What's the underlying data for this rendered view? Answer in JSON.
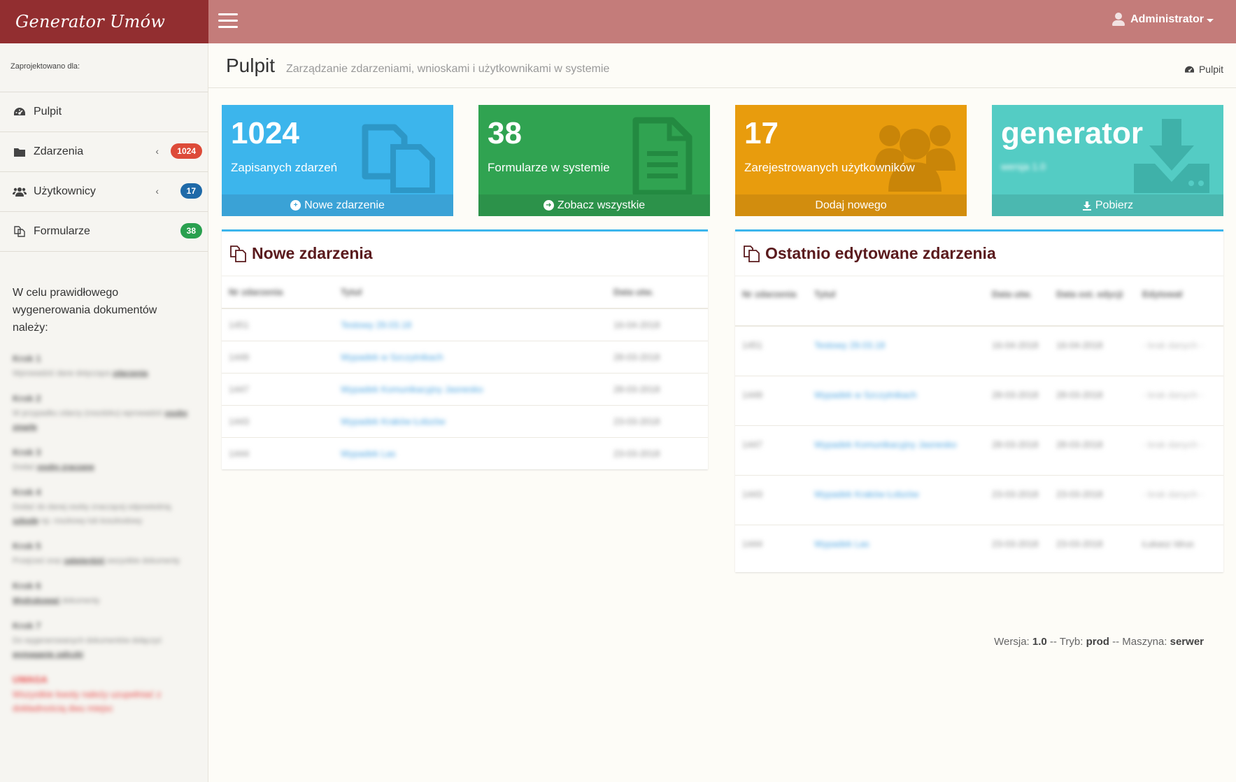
{
  "brand": "Generator Umów",
  "user": {
    "name": "Administrator"
  },
  "sidebar": {
    "designed_for": "Zaprojektowano dla:",
    "items": [
      {
        "label": "Pulpit",
        "icon": "dashboard-icon"
      },
      {
        "label": "Zdarzenia",
        "icon": "folder-icon",
        "badge": "1024",
        "badge_color": "#dd4b39",
        "has_chevron": true
      },
      {
        "label": "Użytkownicy",
        "icon": "users-icon",
        "badge": "17",
        "badge_color": "#1f6aa8",
        "has_chevron": true
      },
      {
        "label": "Formularze",
        "icon": "files-icon",
        "badge": "38",
        "badge_color": "#29a04f"
      }
    ],
    "chevron": "‹",
    "instructions_lead": "W celu prawidłowego wygenerowania dokumentów należy:",
    "steps": [
      {
        "title": "Krok 1",
        "text": "Wprowadzić dane dotyczące",
        "link": "zdarzenia"
      },
      {
        "title": "Krok 2",
        "text": "W przypadku zdarzy (roszdzku) wprowadzić",
        "link": "osoby zmarłe"
      },
      {
        "title": "Krok 3",
        "text": "Dodać",
        "link": "osoby zraczane"
      },
      {
        "title": "Krok 4",
        "text": "Dodać do danej osoby znaczącej odpowiednią",
        "link": "szkodę",
        "text2": "np. roszkowy lub koszkodowy"
      },
      {
        "title": "Krok 5",
        "text": "Przejrzeć oraz",
        "link": "zatwierdzić",
        "text2": "wszystkie dokumenty"
      },
      {
        "title": "Krok 6",
        "text": "",
        "link": "Wydrukować",
        "text2": "dokumenty"
      },
      {
        "title": "Krok 7",
        "text": "Do wygenerowanych dokumentów dołączyć",
        "link": "wymaganie zaliczki"
      }
    ],
    "warning_title": "UWAGA",
    "warning_text": "Wszystkie kwoty należy uzupełniać z dokładnością dwu miejsc"
  },
  "header": {
    "title": "Pulpit",
    "subtitle": "Zarządzanie zdarzeniami, wnioskami i użytkownikami w systemie",
    "breadcrumb": "Pulpit"
  },
  "tiles": [
    {
      "value": "1024",
      "label": "Zapisanych zdarzeń",
      "footer": "Nowe zdarzenie",
      "icon": "files-icon",
      "color": "#3cb5ec"
    },
    {
      "value": "38",
      "label": "Formularze w systemie",
      "footer": "Zobacz wszystkie",
      "icon": "document-icon",
      "color": "#30a351"
    },
    {
      "value": "17",
      "label": "Zarejestrowanych użytkowników",
      "footer": "Dodaj nowego",
      "icon": "users-icon",
      "color": "#e89c0d"
    },
    {
      "value": "generator",
      "label": "wersja 1.0",
      "footer": "Pobierz",
      "icon": "download-icon",
      "color": "#54ccc4"
    }
  ],
  "new_events": {
    "title": "Nowe zdarzenia",
    "columns": [
      "Nr zdarzenia",
      "Tytuł",
      "Data utw."
    ],
    "rows": [
      [
        "1451",
        "Testowy 29.03.18",
        "16-04-2018"
      ],
      [
        "1449",
        "Wypadek w Szczytnikach",
        "28-03-2018"
      ],
      [
        "1447",
        "Wypadek Komunikacyjny Jasnesko",
        "28-03-2018"
      ],
      [
        "1443",
        "Wypadek Kraków Łobzów",
        "23-03-2018"
      ],
      [
        "1444",
        "Wypadek Las",
        "23-03-2018"
      ]
    ]
  },
  "recent_events": {
    "title": "Ostatnio edytowane zdarzenia",
    "columns": [
      "Nr zdarzenia",
      "Tytuł",
      "Data utw.",
      "Data ost. edycji",
      "Edytował"
    ],
    "rows": [
      [
        "1451",
        "Testowy 29.03.18",
        "16-04-2018",
        "16-04-2018",
        "- brak danych -"
      ],
      [
        "1449",
        "Wypadek w Szczytnikach",
        "28-03-2018",
        "28-03-2018",
        "- brak danych -"
      ],
      [
        "1447",
        "Wypadek Komunikacyjny Jasnesko",
        "28-03-2018",
        "28-03-2018",
        "- brak danych -"
      ],
      [
        "1443",
        "Wypadek Kraków Łobzów",
        "23-03-2018",
        "23-03-2018",
        "- brak danych -"
      ],
      [
        "1444",
        "Wypadek Las",
        "23-03-2018",
        "23-03-2018",
        "Łukasz Idrus"
      ]
    ]
  },
  "footer": {
    "version_label": "Wersja:",
    "version": "1.0",
    "mode_label": "-- Tryb:",
    "mode": "prod",
    "machine_label": "-- Maszyna:",
    "machine": "serwer"
  }
}
